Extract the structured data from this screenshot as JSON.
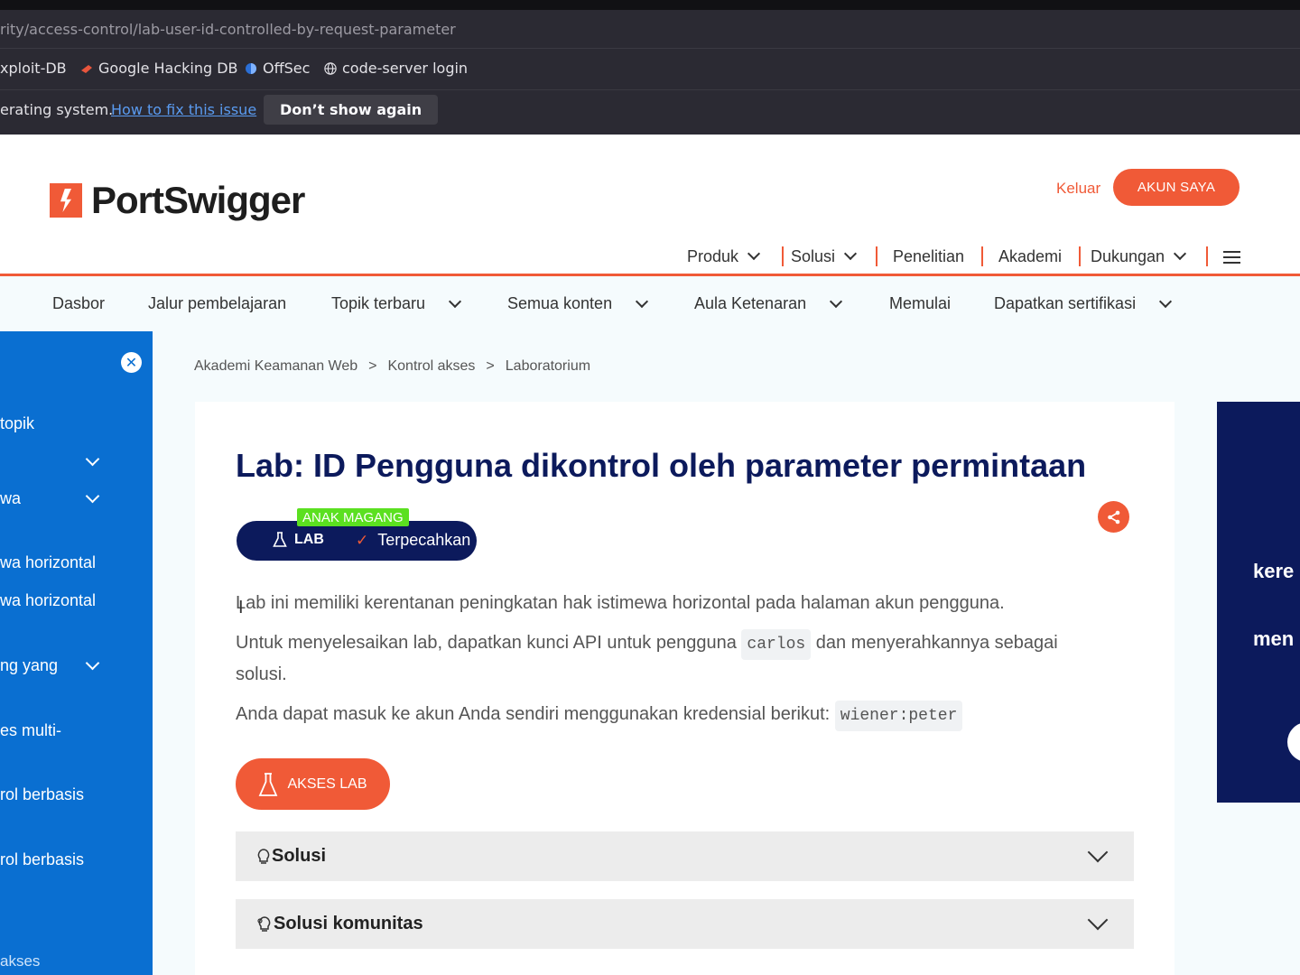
{
  "browser": {
    "url": "rity/access-control/lab-user-id-controlled-by-request-parameter",
    "bookmarks": [
      "xploit-DB",
      "Google Hacking DB",
      "OffSec",
      "code-server login"
    ],
    "notice": {
      "text": "erating system.",
      "link": "How to fix this issue",
      "button": "Don’t show again"
    }
  },
  "header": {
    "logo_text": "PortSwigger",
    "logout": "Keluar",
    "account_button": "AKUN SAYA",
    "nav": [
      "Produk",
      "Solusi",
      "Penelitian",
      "Akademi",
      "Dukungan"
    ]
  },
  "subnav": [
    "Dasbor",
    "Jalur pembelajaran",
    "Topik terbaru",
    "Semua konten",
    "Aula Ketenaran",
    "Memulai",
    "Dapatkan sertifikasi"
  ],
  "sidebar": {
    "items": [
      "topik",
      "wa",
      "wa horizontal",
      "wa horizontal",
      "ng yang",
      "es multi-",
      "rol berbasis",
      "rol berbasis",
      "akses"
    ]
  },
  "breadcrumb": [
    "Akademi Keamanan Web",
    ">",
    "Kontrol akses",
    ">",
    "Laboratorium"
  ],
  "lab": {
    "title": "Lab: ID Pengguna dikontrol oleh parameter permintaan",
    "level": "ANAK MAGANG",
    "type": "LAB",
    "status": "Terpecahkan",
    "para1": "Lab ini memiliki kerentanan peningkatan hak istimewa horizontal pada halaman akun pengguna.",
    "para2_a": "Untuk menyelesaikan lab, dapatkan kunci API untuk pengguna",
    "para2_code": "carlos",
    "para2_b": "dan menyerahkannya sebagai",
    "para2_c": "solusi.",
    "para3": "Anda dapat masuk ke akun Anda sendiri menggunakan kredensial berikut:",
    "para3_code": "wiener:peter",
    "access_button": "AKSES LAB",
    "accordions": [
      "Solusi",
      "Solusi komunitas"
    ]
  },
  "banner": {
    "line1": "kere",
    "line2": "men"
  },
  "colors": {
    "accent": "#f05a37",
    "navy": "#0c1a5c",
    "sidebar": "#0a6fd1",
    "level": "#5be020"
  }
}
